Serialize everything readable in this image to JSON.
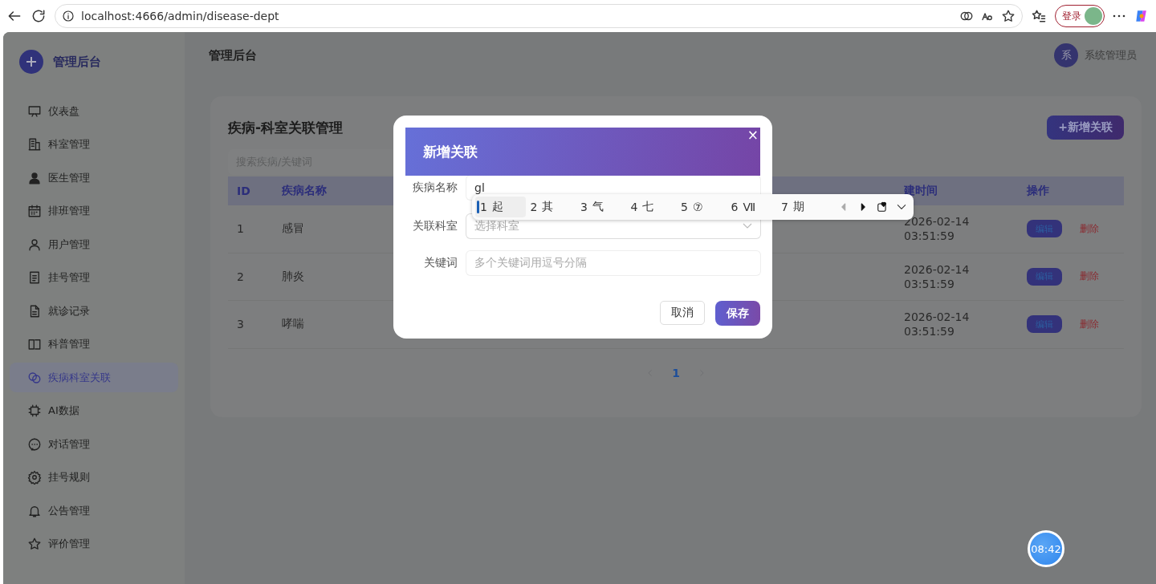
{
  "browser": {
    "url": "localhost:4666/admin/disease-dept",
    "sign_in": "登录"
  },
  "brand": "管理后台",
  "header": {
    "title": "管理后台",
    "user": {
      "avatar": "系",
      "name": "系统管理员"
    }
  },
  "sidebar": {
    "items": [
      {
        "label": "仪表盘",
        "selected": false
      },
      {
        "label": "科室管理",
        "selected": false
      },
      {
        "label": "医生管理",
        "selected": false
      },
      {
        "label": "排班管理",
        "selected": false
      },
      {
        "label": "用户管理",
        "selected": false
      },
      {
        "label": "挂号管理",
        "selected": false
      },
      {
        "label": "就诊记录",
        "selected": false
      },
      {
        "label": "科普管理",
        "selected": false
      },
      {
        "label": "疾病科室关联",
        "selected": true
      },
      {
        "label": "AI数据",
        "selected": false
      },
      {
        "label": "对话管理",
        "selected": false
      },
      {
        "label": "挂号规则",
        "selected": false
      },
      {
        "label": "公告管理",
        "selected": false
      },
      {
        "label": "评价管理",
        "selected": false
      }
    ]
  },
  "page": {
    "title": "疾病-科室关联管理",
    "add_button": "+新增关联",
    "search": {
      "placeholder": "搜索疾病/关键词"
    },
    "table": {
      "columns": [
        "ID",
        "疾病名称",
        "建时间",
        "操作"
      ],
      "rows": [
        {
          "id": "1",
          "name": "感冒",
          "date": "2026-02-14",
          "time": "03:51:59",
          "edit": "编辑",
          "delete": "删除"
        },
        {
          "id": "2",
          "name": "肺炎",
          "date": "2026-02-14",
          "time": "03:51:59",
          "edit": "编辑",
          "delete": "删除"
        },
        {
          "id": "3",
          "name": "哮喘",
          "date": "2026-02-14",
          "time": "03:51:59",
          "edit": "编辑",
          "delete": "删除"
        }
      ]
    },
    "pagination": {
      "pages": [
        {
          "label": "1",
          "selected": true
        }
      ]
    }
  },
  "dialog": {
    "title": "新增关联",
    "close": "×",
    "fields": [
      {
        "label": "疾病名称",
        "kind": "input",
        "value": "gl"
      },
      {
        "label": "关联科室",
        "kind": "select",
        "placeholder": "选择科室"
      },
      {
        "label": "关键词",
        "kind": "input",
        "placeholder": "多个关键词用逗号分隔"
      }
    ],
    "cancel": "取消",
    "save": "保存"
  },
  "ime": {
    "candidates": [
      {
        "index": "1",
        "text": "起",
        "selected": true
      },
      {
        "index": "2",
        "text": "其",
        "selected": false
      },
      {
        "index": "3",
        "text": "气",
        "selected": false
      },
      {
        "index": "4",
        "text": "七",
        "selected": false
      },
      {
        "index": "5",
        "text": "⑦",
        "selected": false
      },
      {
        "index": "6",
        "text": "Ⅶ",
        "selected": false
      },
      {
        "index": "7",
        "text": "期",
        "selected": false
      }
    ]
  },
  "clock": "08:42"
}
